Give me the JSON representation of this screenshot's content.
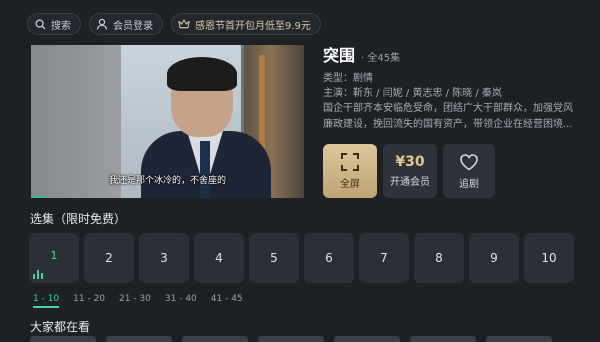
{
  "topbar": {
    "search_label": "搜索",
    "login_label": "会员登录",
    "promo_label": "感恩节首开包月低至9.9元"
  },
  "video": {
    "subtitle": "我还是那个冰冷的，不舍座的",
    "progress_fraction": 0.05
  },
  "show": {
    "title": "突围",
    "episode_count": "· 全45集",
    "genre": "类型：剧情",
    "cast": "主演：靳东 / 闫妮 / 黄志忠 / 陈晓 / 秦岚",
    "description": "国企干部齐本安临危受命，团结广大干部群众，加强党风廉政建设，挽回流失的国有资产，带领企业在经营困境..."
  },
  "actions": {
    "fullscreen_label": "全屏",
    "vip_price": "¥30",
    "vip_label": "开通会员",
    "follow_label": "追剧"
  },
  "episodes_title": "选集（限时免费）",
  "episodes": [
    "1",
    "2",
    "3",
    "4",
    "5",
    "6",
    "7",
    "8",
    "9",
    "10"
  ],
  "ranges": [
    "1 - 10",
    "11 - 20",
    "21 - 30",
    "31 - 40",
    "41 - 45"
  ],
  "recommend_title": "大家都在看",
  "colors": {
    "accent": "#44d39a",
    "gold": "#dcc79b",
    "background": "#1d2126"
  }
}
